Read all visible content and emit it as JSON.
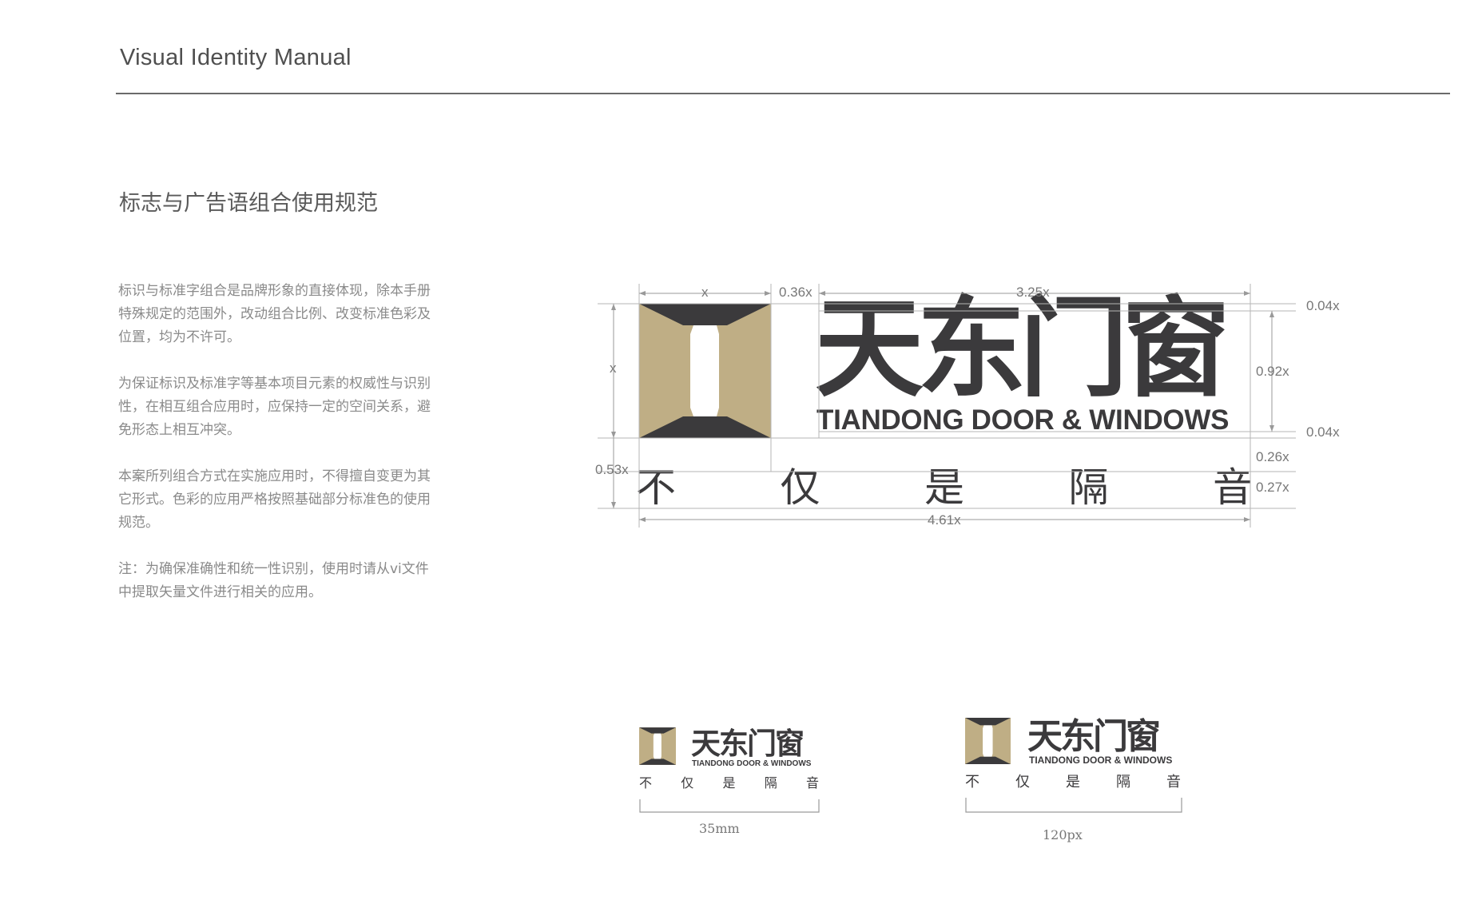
{
  "header": {
    "title": "Visual Identity Manual"
  },
  "section": {
    "title": "标志与广告语组合使用规范"
  },
  "description": {
    "paragraphs": [
      "标识与标准字组合是品牌形象的直接体现，除本手册特殊规定的范围外，改动组合比例、改变标准色彩及位置，均为不许可。",
      "为保证标识及标准字等基本项目元素的权威性与识别性，在相互组合应用时，应保持一定的空间关系，避免形态上相互冲突。",
      "本案所列组合方式在实施应用时，不得擅自变更为其它形式。色彩的应用严格按照基础部分标准色的使用规范。",
      "注：为确保准确性和统一性识别，使用时请从vi文件中提取矢量文件进行相关的应用。"
    ]
  },
  "logo": {
    "brand_cn": "天东门窗",
    "brand_en": "TIANDONG DOOR & WINDOWS",
    "slogan": [
      "不",
      "仅",
      "是",
      "隔",
      "音"
    ],
    "colors": {
      "gold": "#bfae85",
      "dark": "#3b3a3c"
    }
  },
  "dimensions": {
    "x": "x",
    "gap": "0.36x",
    "wordmark_width": "3.25x",
    "top_margin": "0.04x",
    "wordmark_height": "0.92x",
    "bottom_margin": "0.04x",
    "slogan_gap": "0.26x",
    "slogan_height": "0.27x",
    "left_height": "x",
    "left_slogan": "0.53x",
    "total_width": "4.61x"
  },
  "min_sizes": {
    "print": "35mm",
    "screen": "120px"
  }
}
